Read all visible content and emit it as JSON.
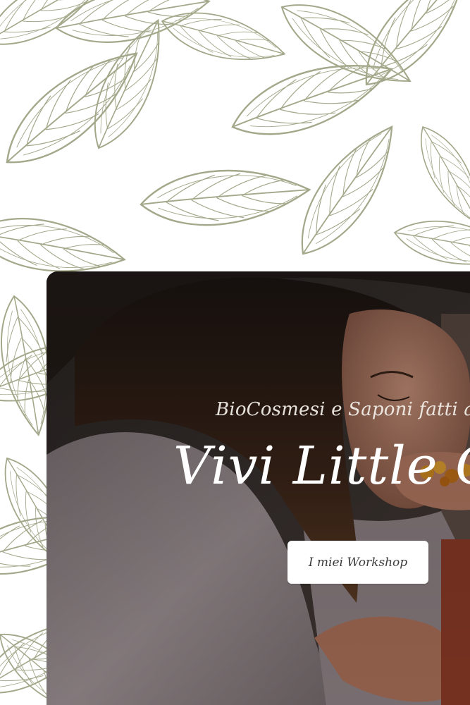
{
  "hero": {
    "subtitle": "BioCosmesi e Saponi fatti a mano",
    "title": "Vivi Little Green",
    "cta_label": "I miei Workshop"
  },
  "colors": {
    "leaf_stroke": "#a3a88a",
    "background": "#ffffff",
    "hero_text": "#ffffff",
    "button_bg": "#ffffff",
    "button_text": "#3b3b3b"
  },
  "icons": {
    "background_pattern": "leaf-pattern-icon"
  }
}
